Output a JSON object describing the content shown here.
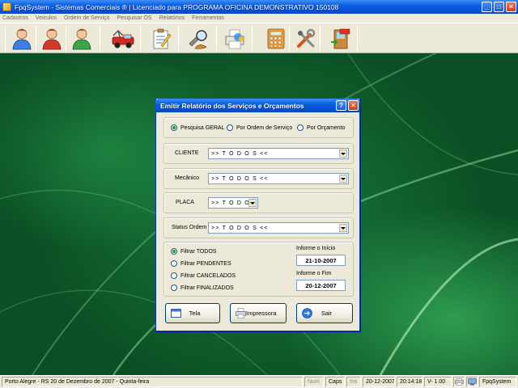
{
  "window": {
    "title": "FpqSystem - Sistemas Comerciais ®  | Licenciado para  PROGRAMA OFICINA DEMONSTRATIVO 150108"
  },
  "menu": [
    "Cadastros",
    "Veiculos",
    "Ordem de Serviço",
    "Pesquisar OS",
    "Relatórios",
    "Ferramentas"
  ],
  "toolbar": {
    "icons": [
      "client-person-icon",
      "mechanic-person-icon",
      "employee-person-icon",
      "vehicle-car-icon",
      "service-order-icon",
      "search-tools-icon",
      "printer-report-icon",
      "calculator-icon",
      "tools-icon",
      "exit-door-icon"
    ]
  },
  "dialog": {
    "title": "Emitir Relatório dos Serviços e Orçamentos",
    "search_options": [
      "Pesquisa GERAL",
      "Por Ordem de Serviço",
      "Por Orçamento"
    ],
    "search_selected": 0,
    "cliente_label": "CLIENTE",
    "cliente_value": ">> T O D O S <<",
    "mecanico_label": "Mecânico",
    "mecanico_value": ">> T O D O S <<",
    "placa_label": "PLACA",
    "placa_value": ">> T O D O S",
    "status_label": "Status Ordem",
    "status_value": ">> T O D O S <<",
    "filters": [
      "Filtrar TODOS",
      "Filtrar PENDENTES",
      "Filtrar CANCELADOS",
      "Filtrar FINALIZADOS"
    ],
    "filter_selected": 0,
    "start_label": "Informe o Início",
    "start_date": "21-10-2007",
    "end_label": "Informe o Fim",
    "end_date": "20-12-2007",
    "buttons": {
      "tela": "Tela",
      "impressora": "Impressora",
      "sair": "Sair"
    }
  },
  "statusbar": {
    "location": "Porto Alegre - RS 20 de Dezembro de 2007 - Quinta-feira",
    "num": "Num",
    "caps": "Caps",
    "ins": "Ins",
    "date": "20-12-2007",
    "time": "20:14:18",
    "version": "V-  1.00",
    "app": "FpqSystem"
  }
}
